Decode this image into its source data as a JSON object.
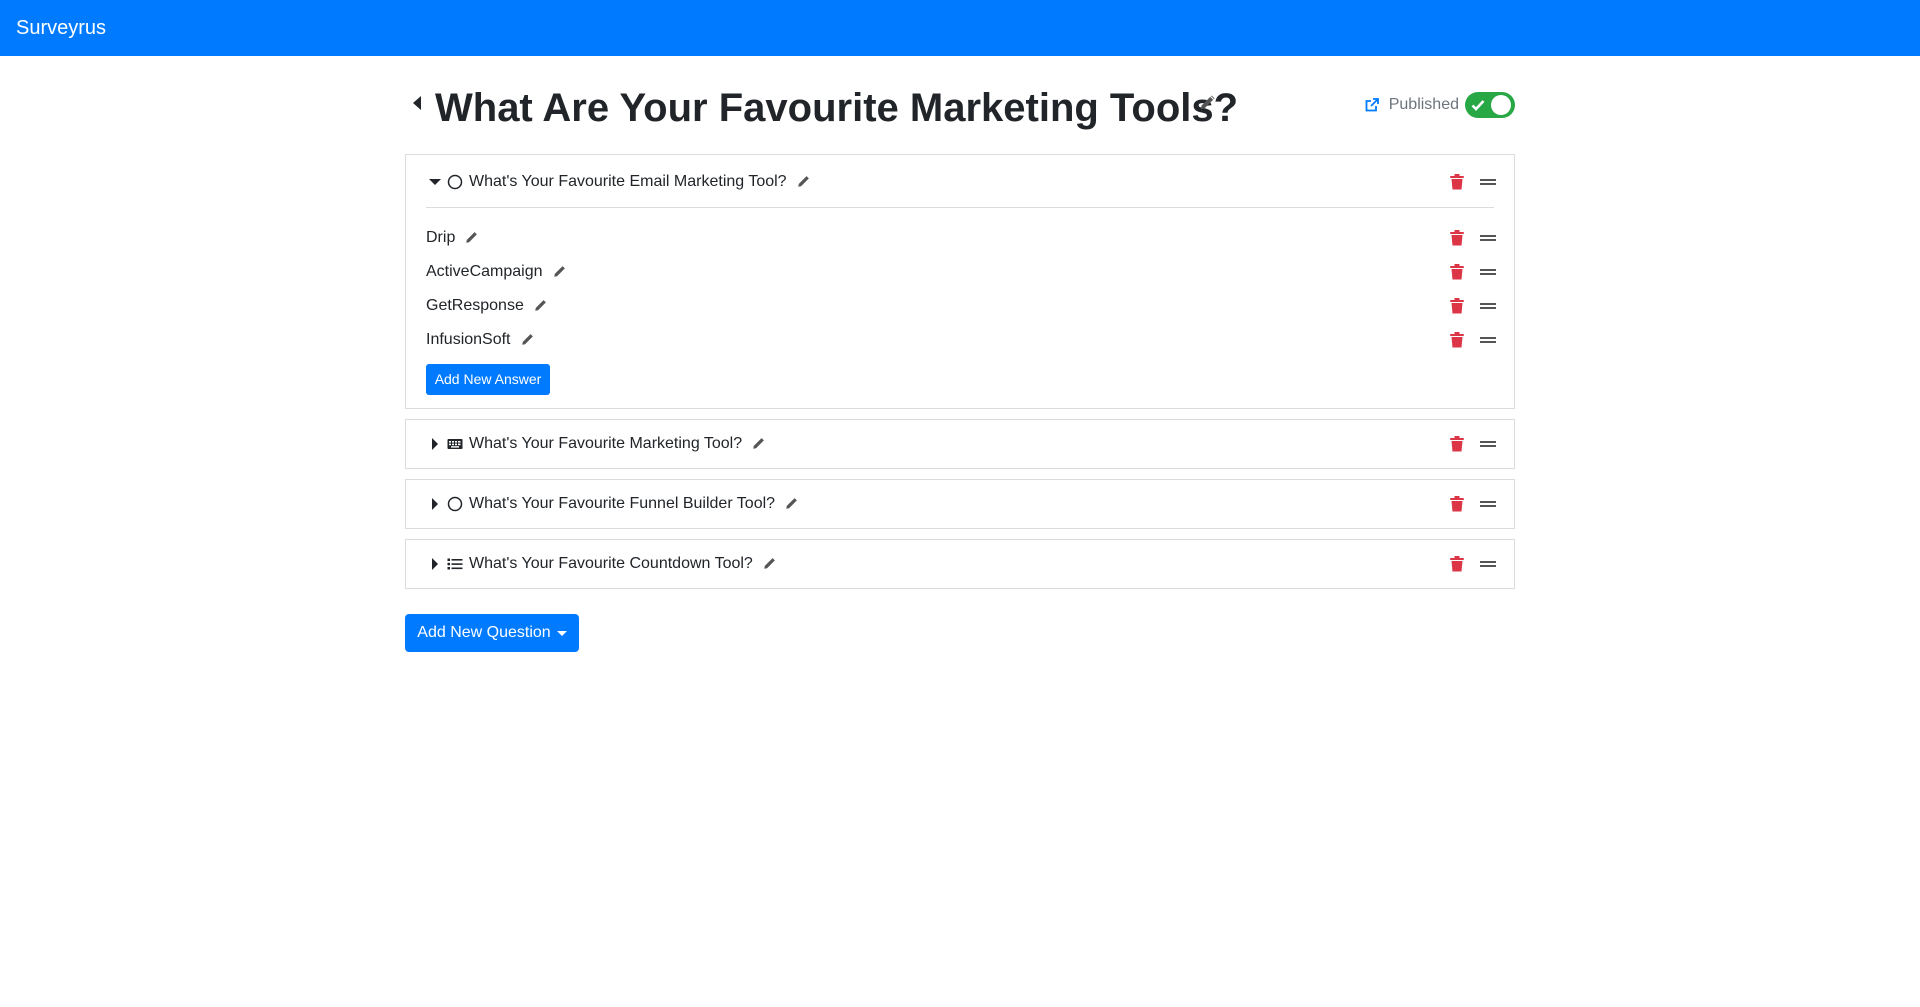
{
  "navbar": {
    "brand": "Surveyrus"
  },
  "survey": {
    "title": "What Are Your Favourite Marketing Tools?",
    "status_label": "Published",
    "published": true
  },
  "questions": [
    {
      "text": "What's Your Favourite Email Marketing Tool?",
      "type_icon": "radio-circle-icon",
      "expanded": true,
      "answers": [
        "Drip",
        "ActiveCampaign",
        "GetResponse",
        "InfusionSoft"
      ],
      "add_answer_label": "Add New Answer"
    },
    {
      "text": "What's Your Favourite Marketing Tool?",
      "type_icon": "keyboard-icon",
      "expanded": false
    },
    {
      "text": "What's Your Favourite Funnel Builder Tool?",
      "type_icon": "radio-circle-icon",
      "expanded": false
    },
    {
      "text": "What's Your Favourite Countdown Tool?",
      "type_icon": "list-icon",
      "expanded": false
    }
  ],
  "add_question_label": "Add New Question",
  "colors": {
    "primary": "#007bff",
    "success": "#28a745",
    "danger": "#dc3545"
  }
}
